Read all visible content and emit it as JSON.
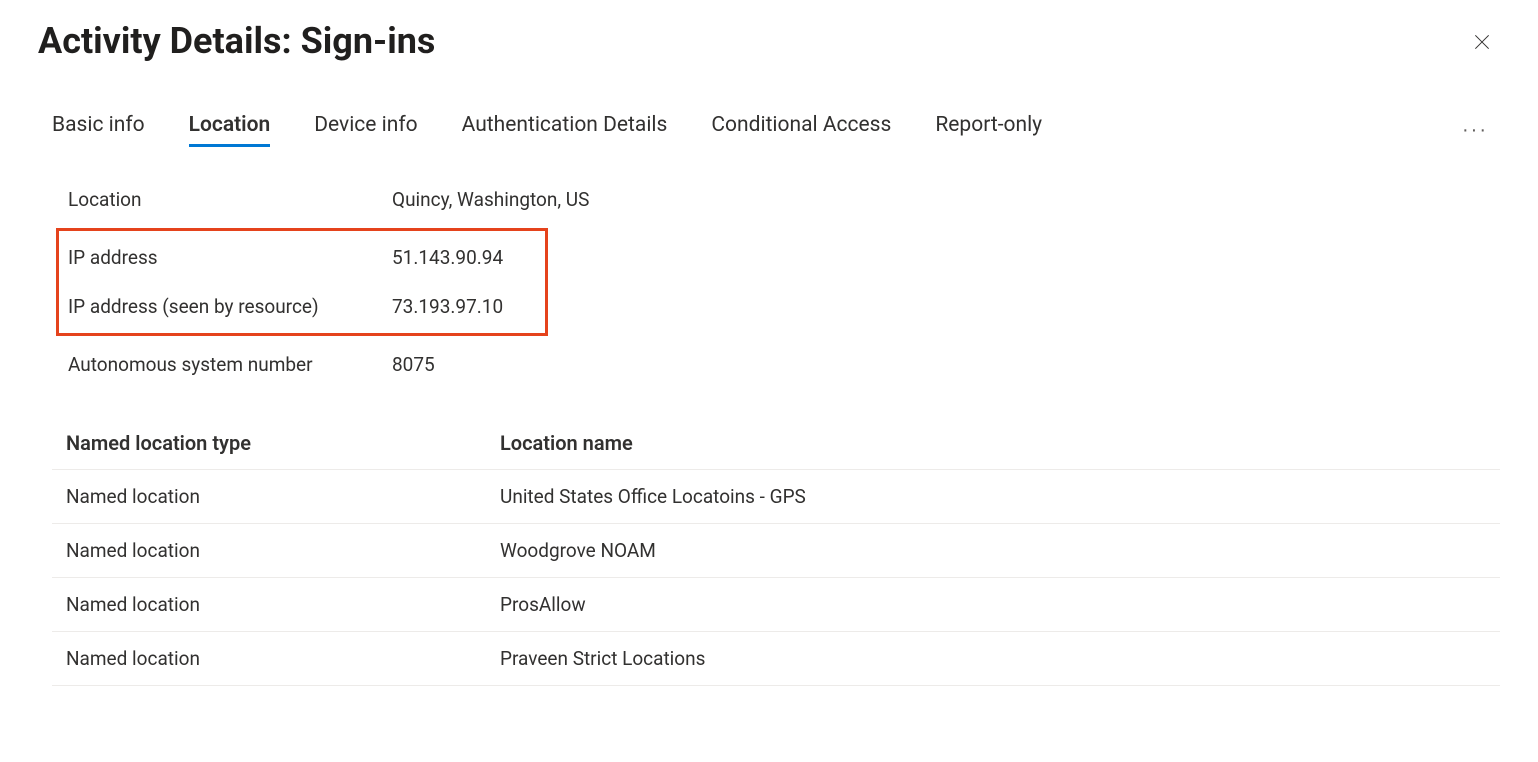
{
  "header": {
    "title": "Activity Details: Sign-ins"
  },
  "tabs": {
    "items": [
      {
        "label": "Basic info",
        "active": false
      },
      {
        "label": "Location",
        "active": true
      },
      {
        "label": "Device info",
        "active": false
      },
      {
        "label": "Authentication Details",
        "active": false
      },
      {
        "label": "Conditional Access",
        "active": false
      },
      {
        "label": "Report-only",
        "active": false
      }
    ]
  },
  "details": {
    "location_label": "Location",
    "location_value": "Quincy, Washington, US",
    "ip_address_label": "IP address",
    "ip_address_value": "51.143.90.94",
    "ip_seen_label": "IP address (seen by resource)",
    "ip_seen_value": "73.193.97.10",
    "asn_label": "Autonomous system number",
    "asn_value": "8075"
  },
  "table": {
    "header_type": "Named location type",
    "header_name": "Location name",
    "rows": [
      {
        "type": "Named location",
        "name": "United States Office Locatoins - GPS"
      },
      {
        "type": "Named location",
        "name": "Woodgrove NOAM"
      },
      {
        "type": "Named location",
        "name": "ProsAllow"
      },
      {
        "type": "Named location",
        "name": "Praveen Strict Locations"
      }
    ]
  }
}
